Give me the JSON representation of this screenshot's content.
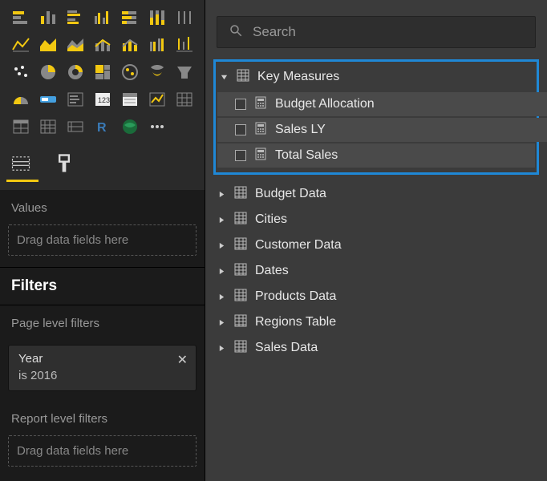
{
  "left": {
    "values_label": "Values",
    "values_placeholder": "Drag data fields here",
    "filters_heading": "Filters",
    "page_filters_label": "Page level filters",
    "report_filters_label": "Report level filters",
    "report_filters_placeholder": "Drag data fields here",
    "filter": {
      "name": "Year",
      "value": "is 2016",
      "close": "✕"
    }
  },
  "right": {
    "search_placeholder": "Search",
    "key_measures": {
      "label": "Key Measures",
      "items": [
        {
          "label": "Budget Allocation"
        },
        {
          "label": "Sales LY"
        },
        {
          "label": "Total Sales"
        }
      ]
    },
    "tables": [
      "Budget Data",
      "Cities",
      "Customer Data",
      "Dates",
      "Products Data",
      "Regions Table",
      "Sales Data"
    ]
  }
}
